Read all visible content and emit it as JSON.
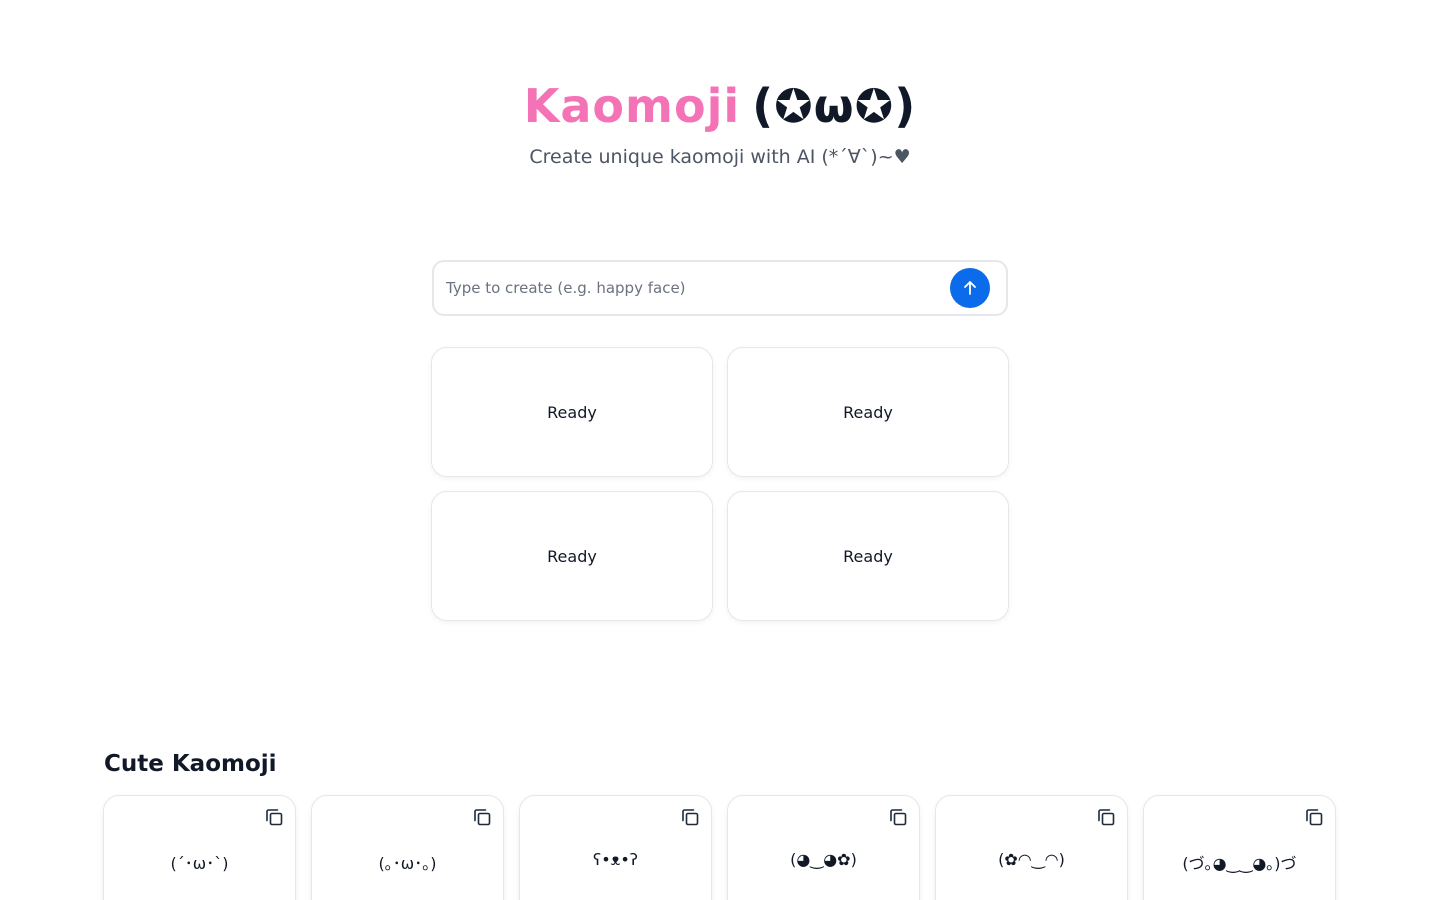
{
  "header": {
    "brand": "Kaomoji",
    "face": "(✪ω✪)",
    "subtitle": "Create unique kaomoji with AI (*´∀`)~♥"
  },
  "search": {
    "placeholder": "Type to create (e.g. happy face)",
    "value": "",
    "submit_icon": "arrow-up-icon",
    "accent": "#0b6bea"
  },
  "results": [
    {
      "status": "Ready"
    },
    {
      "status": "Ready"
    },
    {
      "status": "Ready"
    },
    {
      "status": "Ready"
    }
  ],
  "section": {
    "title": "Cute Kaomoji",
    "items": [
      {
        "text": "(´･ω･`)",
        "icon": "copy-icon"
      },
      {
        "text": "(｡･ω･｡)",
        "icon": "copy-icon"
      },
      {
        "text": "ʕ•ᴥ•ʔ",
        "icon": "copy-icon"
      },
      {
        "text": "(◕‿◕✿)",
        "icon": "copy-icon"
      },
      {
        "text": "(✿◠‿◠)",
        "icon": "copy-icon"
      },
      {
        "text": "(づ｡◕‿‿◕｡)づ",
        "icon": "copy-icon"
      }
    ]
  },
  "colors": {
    "brand": "#f472b6",
    "text": "#111827",
    "muted": "#4b5563",
    "border": "#e5e7eb"
  }
}
